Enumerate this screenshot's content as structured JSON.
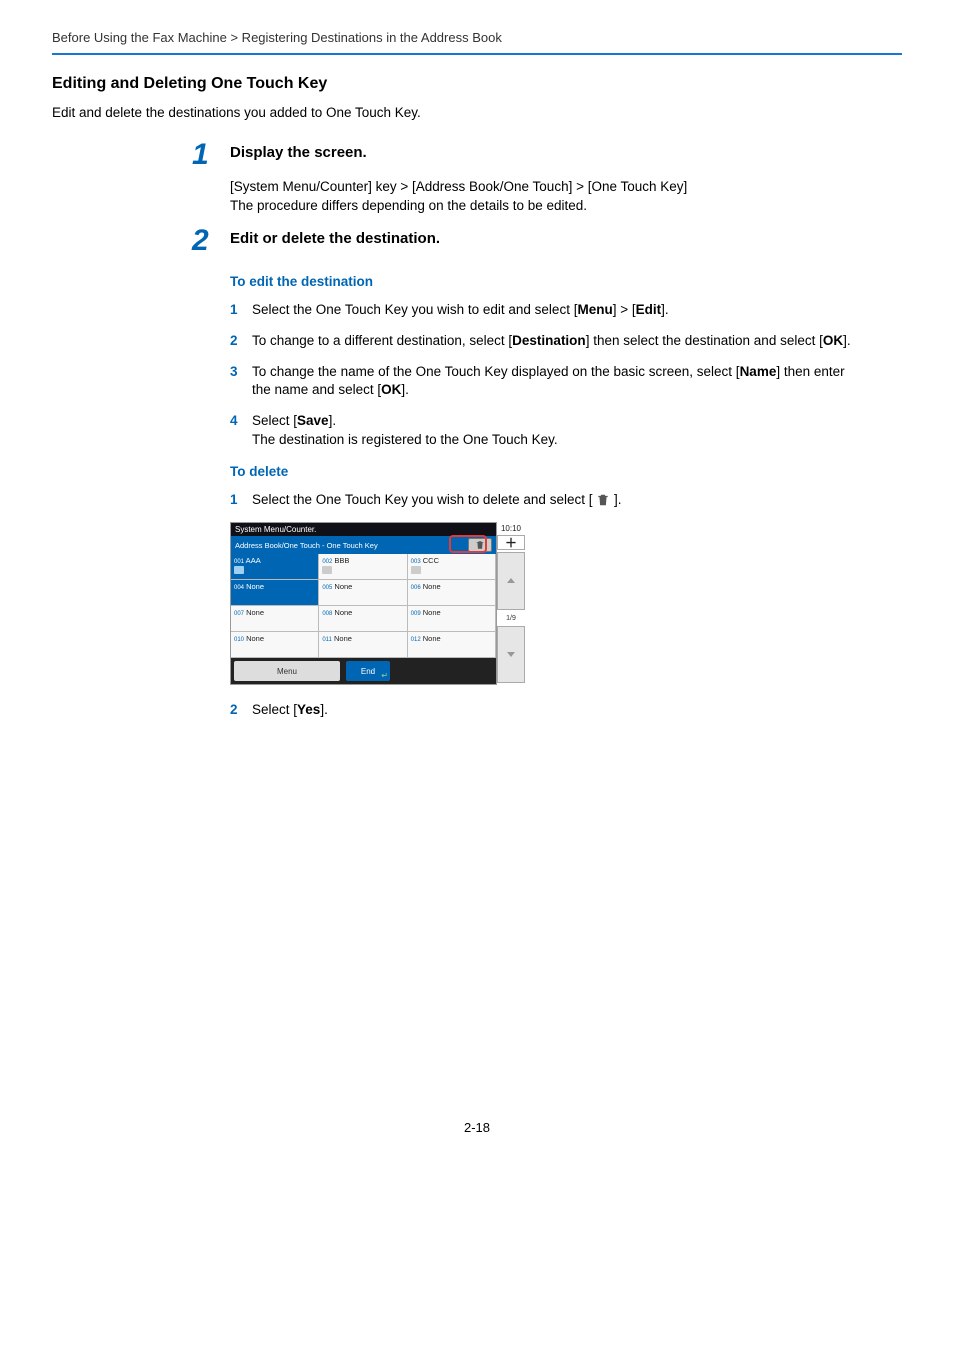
{
  "breadcrumb": "Before Using the Fax Machine > Registering Destinations in the Address Book",
  "section_title": "Editing and Deleting One Touch Key",
  "lead": "Edit and delete the destinations you added to One Touch Key.",
  "step1": {
    "num": "1",
    "heading": "Display the screen.",
    "path_pre": "[",
    "path_b1": "System Menu/Counter",
    "path_mid1": "] key > [",
    "path_b2": "Address Book/One Touch",
    "path_mid2": "] > [",
    "path_b3": "One Touch Key",
    "path_post": "]",
    "line2": "The procedure differs depending on the details to be edited."
  },
  "step2": {
    "num": "2",
    "heading": "Edit or delete the destination.",
    "edit_head": "To edit the destination",
    "s1": {
      "n": "1",
      "pre": "Select the One Touch Key you wish to edit and select [",
      "b1": "Menu",
      "mid": "] > [",
      "b2": "Edit",
      "post": "]."
    },
    "s2": {
      "n": "2",
      "pre": "To change to a different destination, select [",
      "b1": "Destination",
      "mid": "] then select the destination and select [",
      "b2": "OK",
      "post": "]."
    },
    "s3": {
      "n": "3",
      "pre": "To change the name of the One Touch Key displayed on the basic screen, select [",
      "b1": "Name",
      "mid": "] then enter the name and select [",
      "b2": "OK",
      "post": "]."
    },
    "s4": {
      "n": "4",
      "pre": "Select [",
      "b1": "Save",
      "post": "].",
      "line2": "The destination is registered to the One Touch Key."
    },
    "del_head": "To delete",
    "d1": {
      "n": "1",
      "pre": "Select the One Touch Key you wish to delete and select [ ",
      "post": " ]."
    },
    "d2": {
      "n": "2",
      "pre": "Select [",
      "b1": "Yes",
      "post": "]."
    }
  },
  "device": {
    "header": "System Menu/Counter.",
    "subheader": "Address Book/One Touch - One Touch Key",
    "time": "10:10",
    "page": "1/9",
    "menu": "Menu",
    "end": "End",
    "cells": [
      {
        "idx": "001",
        "label": "AAA",
        "icon": true,
        "selected": true
      },
      {
        "idx": "002",
        "label": "BBB",
        "icon": true,
        "selected": false
      },
      {
        "idx": "003",
        "label": "CCC",
        "icon": true,
        "selected": false
      },
      {
        "idx": "004",
        "label": "None",
        "icon": false,
        "selected": true
      },
      {
        "idx": "005",
        "label": "None",
        "icon": false,
        "selected": false
      },
      {
        "idx": "006",
        "label": "None",
        "icon": false,
        "selected": false
      },
      {
        "idx": "007",
        "label": "None",
        "icon": false,
        "selected": false
      },
      {
        "idx": "008",
        "label": "None",
        "icon": false,
        "selected": false
      },
      {
        "idx": "009",
        "label": "None",
        "icon": false,
        "selected": false
      },
      {
        "idx": "010",
        "label": "None",
        "icon": false,
        "selected": false
      },
      {
        "idx": "011",
        "label": "None",
        "icon": false,
        "selected": false
      },
      {
        "idx": "012",
        "label": "None",
        "icon": false,
        "selected": false
      }
    ]
  },
  "pagenum": "2-18"
}
